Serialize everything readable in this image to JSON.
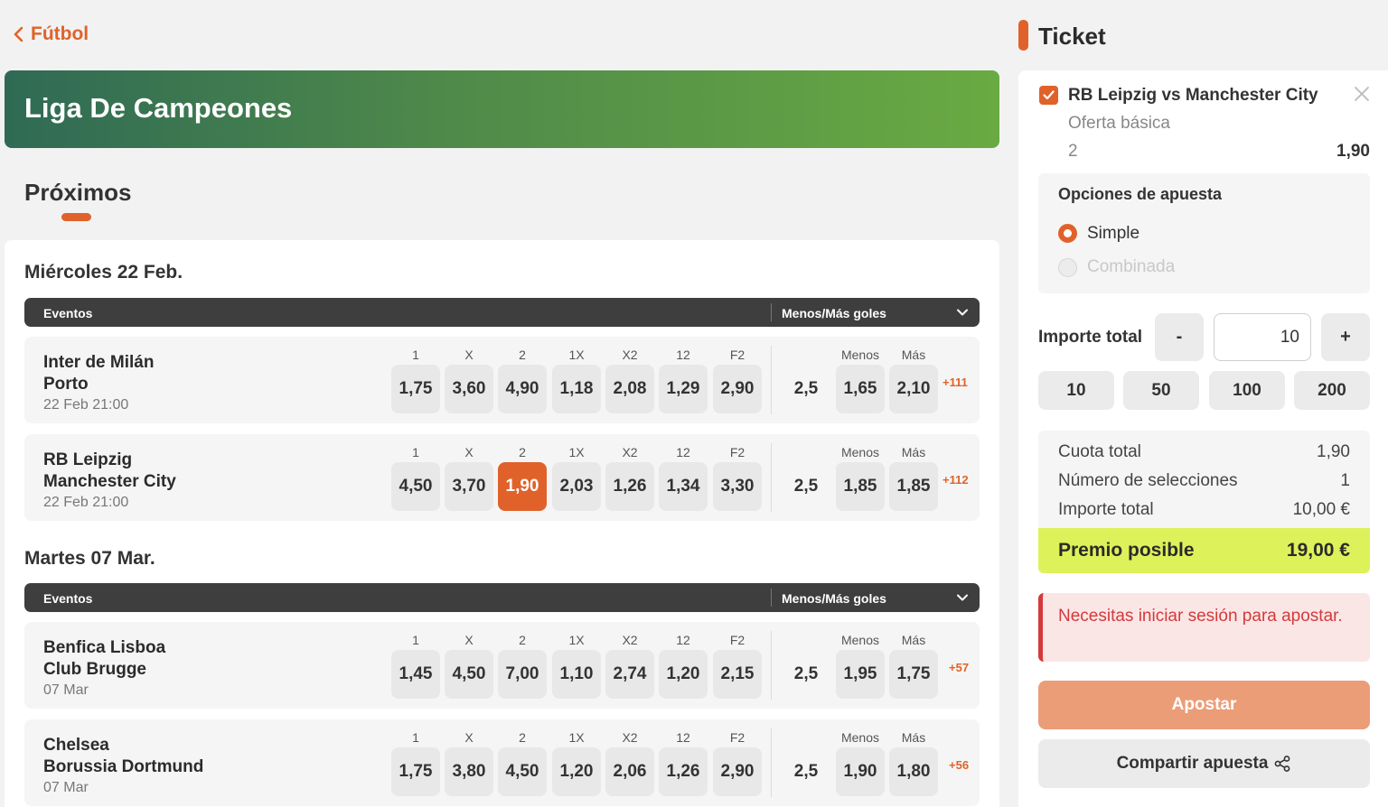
{
  "nav": {
    "back_label": "Fútbol"
  },
  "league": {
    "title": "Liga De Campeones"
  },
  "section": {
    "title": "Próximos"
  },
  "table_headers": {
    "events": "Eventos",
    "market": "Menos/Más goles"
  },
  "odds_labels": [
    "1",
    "X",
    "2",
    "1X",
    "X2",
    "12",
    "F2",
    "Menos",
    "Más"
  ],
  "days": [
    {
      "title": "Miércoles 22 Feb.",
      "matches": [
        {
          "team1": "Inter de Milán",
          "team2": "Porto",
          "when": "22 Feb 21:00",
          "odds": [
            "1,75",
            "3,60",
            "4,90",
            "1,18",
            "2,08",
            "1,29",
            "2,90"
          ],
          "line": "2,5",
          "under": "1,65",
          "over": "2,10",
          "more": "+111"
        },
        {
          "team1": "RB Leipzig",
          "team2": "Manchester City",
          "when": "22 Feb 21:00",
          "odds": [
            "4,50",
            "3,70",
            "1,90",
            "2,03",
            "1,26",
            "1,34",
            "3,30"
          ],
          "line": "2,5",
          "under": "1,85",
          "over": "1,85",
          "more": "+112"
        }
      ]
    },
    {
      "title": "Martes 07 Mar.",
      "matches": [
        {
          "team1": "Benfica Lisboa",
          "team2": "Club Brugge",
          "when": "07 Mar",
          "odds": [
            "1,45",
            "4,50",
            "7,00",
            "1,10",
            "2,74",
            "1,20",
            "2,15"
          ],
          "line": "2,5",
          "under": "1,95",
          "over": "1,75",
          "more": "+57"
        },
        {
          "team1": "Chelsea",
          "team2": "Borussia Dortmund",
          "when": "07 Mar",
          "odds": [
            "1,75",
            "3,80",
            "4,50",
            "1,20",
            "2,06",
            "1,26",
            "2,90"
          ],
          "line": "2,5",
          "under": "1,90",
          "over": "1,80",
          "more": "+56"
        }
      ]
    }
  ],
  "ticket": {
    "title": "Ticket",
    "selection": {
      "match": "RB Leipzig vs Manchester City",
      "market": "Oferta básica",
      "pick": "2",
      "odd": "1,90"
    },
    "options_title": "Opciones de apuesta",
    "option_simple": "Simple",
    "option_combined": "Combinada",
    "amount_label": "Importe total",
    "minus": "-",
    "plus": "+",
    "amount_value": "10",
    "quick_amounts": [
      "10",
      "50",
      "100",
      "200"
    ],
    "summary": {
      "odds_label": "Cuota total",
      "odds_value": "1,90",
      "count_label": "Número de selecciones",
      "count_value": "1",
      "amount_label": "Importe total",
      "amount_value": "10,00 €",
      "prize_label": "Premio posible",
      "prize_value": "19,00 €"
    },
    "login_message": "Necesitas iniciar sesión para apostar.",
    "bet_button": "Apostar",
    "share_button": "Compartir apuesta"
  },
  "colors": {
    "accent": "#e0622a",
    "prize": "#ddf25a",
    "alert": "#d43a3a",
    "header_dark": "#3e3e3e"
  }
}
